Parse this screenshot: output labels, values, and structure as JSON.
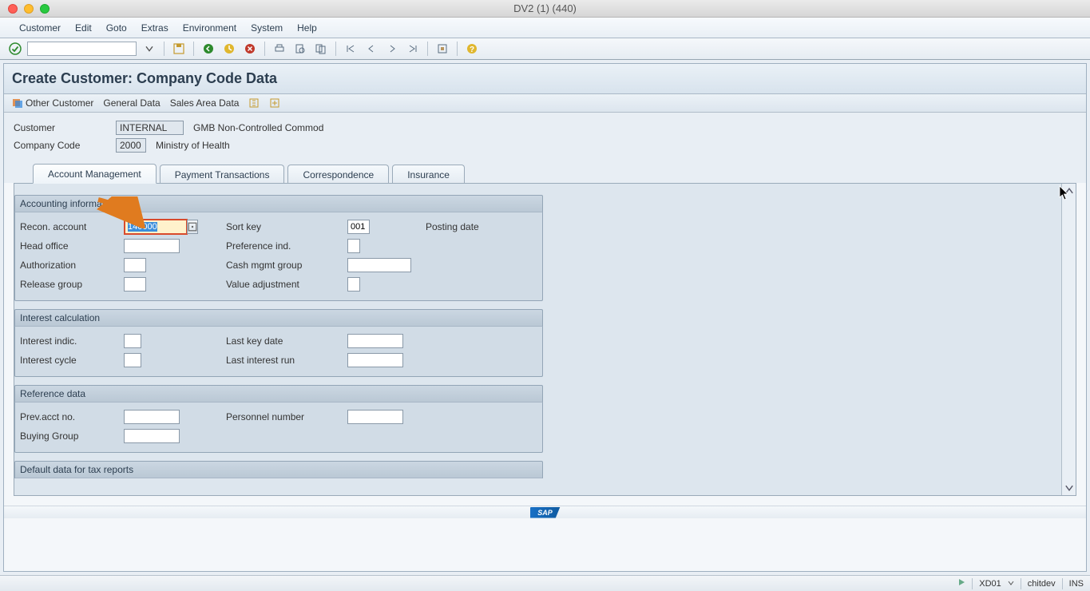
{
  "window": {
    "title": "DV2 (1) (440)"
  },
  "menubar": [
    "Customer",
    "Edit",
    "Goto",
    "Extras",
    "Environment",
    "System",
    "Help"
  ],
  "page_title": "Create Customer: Company Code Data",
  "actionbar": {
    "other_customer": "Other Customer",
    "general_data": "General Data",
    "sales_area_data": "Sales Area Data"
  },
  "header": {
    "customer_label": "Customer",
    "customer_value": "INTERNAL",
    "customer_desc": "GMB Non-Controlled Commod",
    "company_code_label": "Company Code",
    "company_code_value": "2000",
    "company_code_desc": "Ministry of  Health"
  },
  "tabs": [
    "Account Management",
    "Payment Transactions",
    "Correspondence",
    "Insurance"
  ],
  "groups": {
    "accounting_info": {
      "title": "Accounting information",
      "recon_account_label": "Recon. account",
      "recon_account_value": "140000",
      "sort_key_label": "Sort key",
      "sort_key_value": "001",
      "posting_date_label": "Posting date",
      "head_office_label": "Head office",
      "preference_ind_label": "Preference ind.",
      "authorization_label": "Authorization",
      "cash_mgmt_label": "Cash mgmt group",
      "release_group_label": "Release group",
      "value_adj_label": "Value adjustment"
    },
    "interest_calc": {
      "title": "Interest calculation",
      "interest_indic_label": "Interest indic.",
      "last_key_date_label": "Last key date",
      "interest_cycle_label": "Interest cycle",
      "last_interest_run_label": "Last interest run"
    },
    "reference_data": {
      "title": "Reference data",
      "prev_acct_label": "Prev.acct no.",
      "personnel_no_label": "Personnel number",
      "buying_group_label": "Buying Group"
    },
    "default_tax": {
      "title": "Default data for tax reports"
    }
  },
  "statusbar": {
    "tcode": "XD01",
    "user": "chitdev",
    "mode": "INS"
  }
}
